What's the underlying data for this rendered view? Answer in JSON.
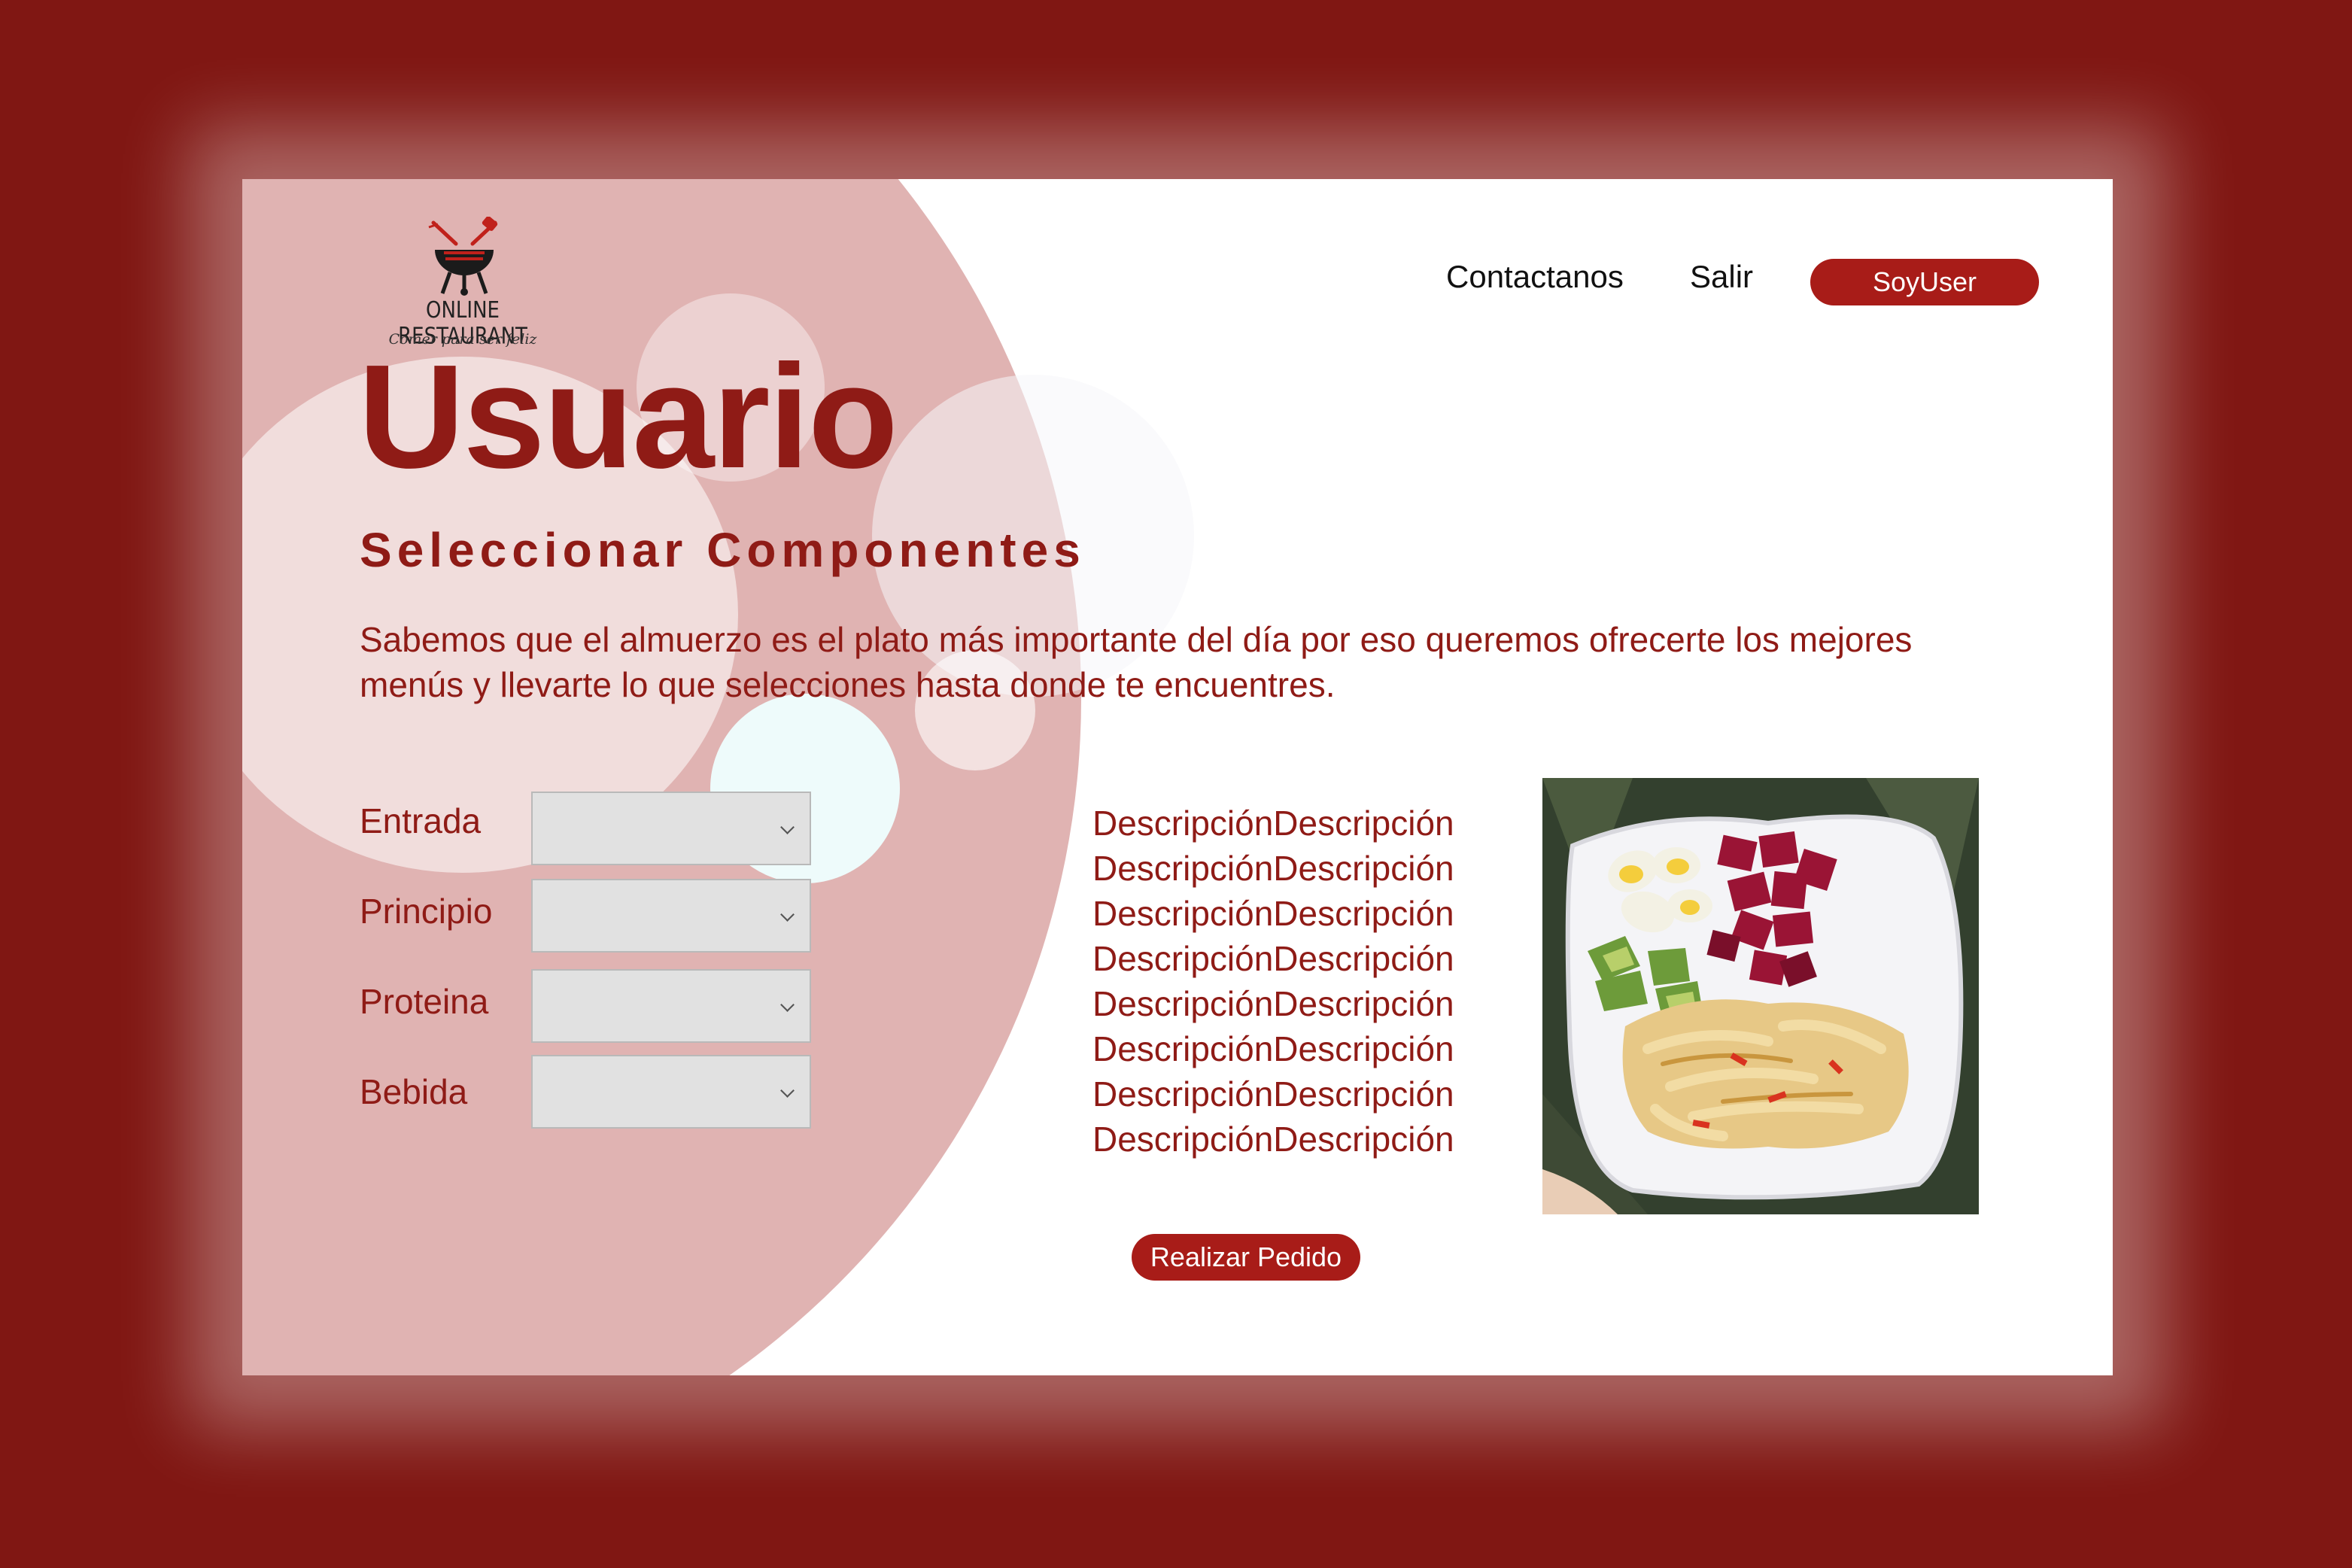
{
  "logo": {
    "name": "ONLINE RESTAURANT",
    "tagline": "Comer para ser feliz"
  },
  "nav": {
    "contact": "Contactanos",
    "exit": "Salir",
    "user_button": "SoyUser"
  },
  "page": {
    "title": "Usuario",
    "subtitle": "Seleccionar Componentes",
    "intro": "Sabemos que el almuerzo es el plato más importante del día por eso queremos ofrecerte los mejores menús y llevarte lo que selecciones hasta donde te encuentres."
  },
  "form": {
    "fields": [
      {
        "label": "Entrada",
        "value": ""
      },
      {
        "label": "Principio",
        "value": ""
      },
      {
        "label": "Proteina",
        "value": ""
      },
      {
        "label": "Bebida",
        "value": ""
      }
    ]
  },
  "description": {
    "lines": [
      "DescripciónDescripción",
      "DescripciónDescripción",
      "DescripciónDescripción",
      "DescripciónDescripción",
      "DescripciónDescripción",
      "DescripciónDescripción",
      "DescripciónDescripción",
      "DescripciónDescripción"
    ]
  },
  "actions": {
    "order_button": "Realizar Pedido"
  },
  "colors": {
    "frame": "#801713",
    "accent": "#a81c18",
    "text": "#8f1b16",
    "blob": "#e0b3b2"
  }
}
